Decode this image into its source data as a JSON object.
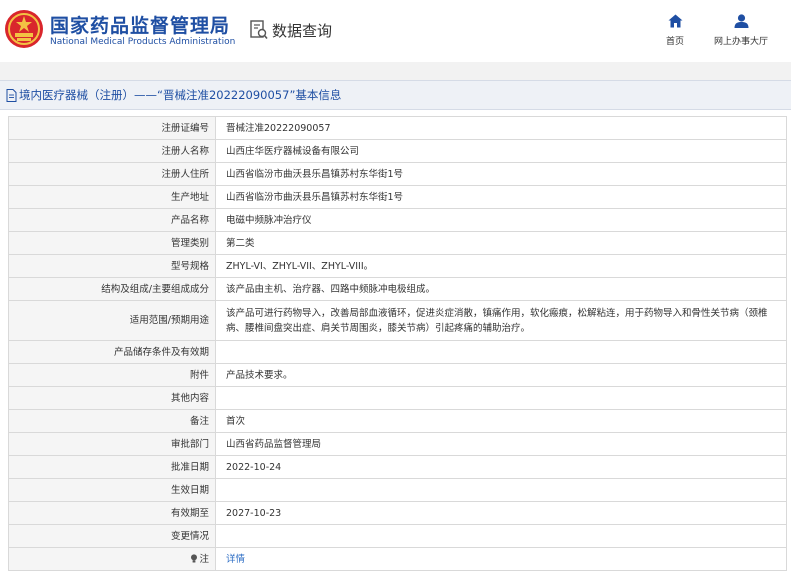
{
  "header": {
    "brand_cn": "国家药品监督管理局",
    "brand_en": "National Medical Products Administration",
    "page_heading": "数据查询",
    "nav": [
      {
        "label": "首页",
        "icon": "home-icon"
      },
      {
        "label": "网上办事大厅",
        "icon": "user-icon"
      }
    ]
  },
  "title_bar": {
    "text": "境内医疗器械（注册）——“晋械注准20222090057”基本信息",
    "icon": "document-icon"
  },
  "colors": {
    "brand_blue": "#1f4fa3",
    "link_blue": "#2b6cc4",
    "label_bg": "#f5f5f5",
    "title_bar_bg": "#eef1f6"
  },
  "rows": [
    {
      "label": "注册证编号",
      "value": "晋械注准20222090057"
    },
    {
      "label": "注册人名称",
      "value": "山西庄华医疗器械设备有限公司"
    },
    {
      "label": "注册人住所",
      "value": "山西省临汾市曲沃县乐昌镇苏村东华街1号"
    },
    {
      "label": "生产地址",
      "value": "山西省临汾市曲沃县乐昌镇苏村东华街1号"
    },
    {
      "label": "产品名称",
      "value": "电磁中频脉冲治疗仪"
    },
    {
      "label": "管理类别",
      "value": "第二类"
    },
    {
      "label": "型号规格",
      "value": "ZHYL-VI、ZHYL-VII、ZHYL-VIII。"
    },
    {
      "label": "结构及组成/主要组成成分",
      "value": "该产品由主机、治疗器、四路中频脉冲电极组成。"
    },
    {
      "label": "适用范围/预期用途",
      "value": "该产品可进行药物导入，改善局部血液循环，促进炎症消散，镇痛作用，软化瘢痕，松解粘连，用于药物导入和骨性关节病（颈椎病、腰椎间盘突出症、肩关节周围炎，膝关节病）引起疼痛的辅助治疗。"
    },
    {
      "label": "产品储存条件及有效期",
      "value": ""
    },
    {
      "label": "附件",
      "value": "产品技术要求。"
    },
    {
      "label": "其他内容",
      "value": ""
    },
    {
      "label": "备注",
      "value": "首次"
    },
    {
      "label": "审批部门",
      "value": "山西省药品监督管理局"
    },
    {
      "label": "批准日期",
      "value": "2022-10-24"
    },
    {
      "label": "生效日期",
      "value": ""
    },
    {
      "label": "有效期至",
      "value": "2027-10-23"
    },
    {
      "label": "变更情况",
      "value": ""
    },
    {
      "label": "注",
      "value": "详情",
      "label_icon": "lightbulb-icon"
    }
  ]
}
